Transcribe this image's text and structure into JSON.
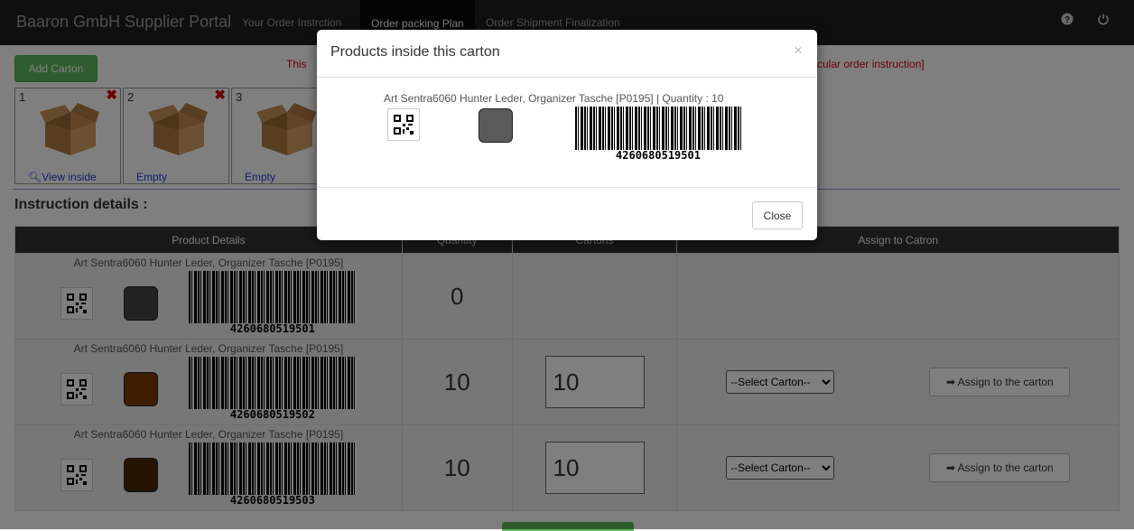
{
  "navbar": {
    "brand": "Baaron GmbH Supplier Portal",
    "links": [
      "Your Order Instrction",
      "Order packing Plan",
      "Order Shipment Finalization"
    ],
    "icons": [
      "help-icon",
      "power-icon"
    ]
  },
  "toolbar": {
    "add_carton_label": "Add Carton",
    "warning_left": "This",
    "warning_right": "cular order instruction]"
  },
  "cartons": [
    {
      "number": "1",
      "label": "View inside",
      "has_delete": true
    },
    {
      "number": "2",
      "label": "Empty",
      "has_delete": true
    },
    {
      "number": "3",
      "label": "Empty",
      "has_delete": false
    }
  ],
  "section_title": "Instruction details :",
  "table": {
    "headers": [
      "Product Details",
      "Quantity",
      "Cartons",
      "Assign to Catron"
    ],
    "rows": [
      {
        "product": "Art Sentra6060 Hunter Leder, Organizer Tasche [P0195]",
        "color": "#444444",
        "barcode": "4260680519501",
        "quantity": "0",
        "count": "",
        "select": "",
        "assign": ""
      },
      {
        "product": "Art Sentra6060 Hunter Leder, Organizer Tasche [P0195]",
        "color": "#7a3d05",
        "barcode": "4260680519502",
        "quantity": "10",
        "count": "10",
        "select": "--Select Carton--",
        "assign": "Assign to the carton"
      },
      {
        "product": "Art Sentra6060 Hunter Leder, Organizer Tasche [P0195]",
        "color": "#4a2808",
        "barcode": "4260680519503",
        "quantity": "10",
        "count": "10",
        "select": "--Select Carton--",
        "assign": "Assign to the carton"
      }
    ]
  },
  "modal": {
    "title": "Products inside this carton",
    "close_x": "×",
    "product_line": "Art Sentra6060 Hunter Leder, Organizer Tasche [P0195] | Quantity : 10",
    "color": "#5a5a5a",
    "barcode": "4260680519501",
    "close_label": "Close"
  },
  "colors": {
    "accent_green": "#5cb85c",
    "danger_red": "#d9000d",
    "navbar": "#1f1f1f"
  }
}
